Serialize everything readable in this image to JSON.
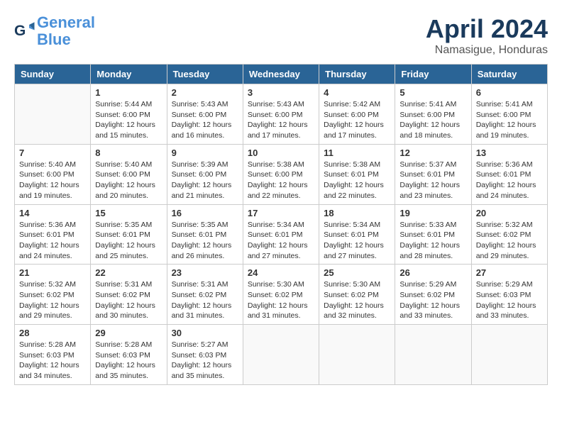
{
  "header": {
    "logo_line1": "General",
    "logo_line2": "Blue",
    "month": "April 2024",
    "location": "Namasigue, Honduras"
  },
  "weekdays": [
    "Sunday",
    "Monday",
    "Tuesday",
    "Wednesday",
    "Thursday",
    "Friday",
    "Saturday"
  ],
  "weeks": [
    [
      {
        "day": "",
        "info": ""
      },
      {
        "day": "1",
        "info": "Sunrise: 5:44 AM\nSunset: 6:00 PM\nDaylight: 12 hours\nand 15 minutes."
      },
      {
        "day": "2",
        "info": "Sunrise: 5:43 AM\nSunset: 6:00 PM\nDaylight: 12 hours\nand 16 minutes."
      },
      {
        "day": "3",
        "info": "Sunrise: 5:43 AM\nSunset: 6:00 PM\nDaylight: 12 hours\nand 17 minutes."
      },
      {
        "day": "4",
        "info": "Sunrise: 5:42 AM\nSunset: 6:00 PM\nDaylight: 12 hours\nand 17 minutes."
      },
      {
        "day": "5",
        "info": "Sunrise: 5:41 AM\nSunset: 6:00 PM\nDaylight: 12 hours\nand 18 minutes."
      },
      {
        "day": "6",
        "info": "Sunrise: 5:41 AM\nSunset: 6:00 PM\nDaylight: 12 hours\nand 19 minutes."
      }
    ],
    [
      {
        "day": "7",
        "info": "Sunrise: 5:40 AM\nSunset: 6:00 PM\nDaylight: 12 hours\nand 19 minutes."
      },
      {
        "day": "8",
        "info": "Sunrise: 5:40 AM\nSunset: 6:00 PM\nDaylight: 12 hours\nand 20 minutes."
      },
      {
        "day": "9",
        "info": "Sunrise: 5:39 AM\nSunset: 6:00 PM\nDaylight: 12 hours\nand 21 minutes."
      },
      {
        "day": "10",
        "info": "Sunrise: 5:38 AM\nSunset: 6:00 PM\nDaylight: 12 hours\nand 22 minutes."
      },
      {
        "day": "11",
        "info": "Sunrise: 5:38 AM\nSunset: 6:01 PM\nDaylight: 12 hours\nand 22 minutes."
      },
      {
        "day": "12",
        "info": "Sunrise: 5:37 AM\nSunset: 6:01 PM\nDaylight: 12 hours\nand 23 minutes."
      },
      {
        "day": "13",
        "info": "Sunrise: 5:36 AM\nSunset: 6:01 PM\nDaylight: 12 hours\nand 24 minutes."
      }
    ],
    [
      {
        "day": "14",
        "info": "Sunrise: 5:36 AM\nSunset: 6:01 PM\nDaylight: 12 hours\nand 24 minutes."
      },
      {
        "day": "15",
        "info": "Sunrise: 5:35 AM\nSunset: 6:01 PM\nDaylight: 12 hours\nand 25 minutes."
      },
      {
        "day": "16",
        "info": "Sunrise: 5:35 AM\nSunset: 6:01 PM\nDaylight: 12 hours\nand 26 minutes."
      },
      {
        "day": "17",
        "info": "Sunrise: 5:34 AM\nSunset: 6:01 PM\nDaylight: 12 hours\nand 27 minutes."
      },
      {
        "day": "18",
        "info": "Sunrise: 5:34 AM\nSunset: 6:01 PM\nDaylight: 12 hours\nand 27 minutes."
      },
      {
        "day": "19",
        "info": "Sunrise: 5:33 AM\nSunset: 6:01 PM\nDaylight: 12 hours\nand 28 minutes."
      },
      {
        "day": "20",
        "info": "Sunrise: 5:32 AM\nSunset: 6:02 PM\nDaylight: 12 hours\nand 29 minutes."
      }
    ],
    [
      {
        "day": "21",
        "info": "Sunrise: 5:32 AM\nSunset: 6:02 PM\nDaylight: 12 hours\nand 29 minutes."
      },
      {
        "day": "22",
        "info": "Sunrise: 5:31 AM\nSunset: 6:02 PM\nDaylight: 12 hours\nand 30 minutes."
      },
      {
        "day": "23",
        "info": "Sunrise: 5:31 AM\nSunset: 6:02 PM\nDaylight: 12 hours\nand 31 minutes."
      },
      {
        "day": "24",
        "info": "Sunrise: 5:30 AM\nSunset: 6:02 PM\nDaylight: 12 hours\nand 31 minutes."
      },
      {
        "day": "25",
        "info": "Sunrise: 5:30 AM\nSunset: 6:02 PM\nDaylight: 12 hours\nand 32 minutes."
      },
      {
        "day": "26",
        "info": "Sunrise: 5:29 AM\nSunset: 6:02 PM\nDaylight: 12 hours\nand 33 minutes."
      },
      {
        "day": "27",
        "info": "Sunrise: 5:29 AM\nSunset: 6:03 PM\nDaylight: 12 hours\nand 33 minutes."
      }
    ],
    [
      {
        "day": "28",
        "info": "Sunrise: 5:28 AM\nSunset: 6:03 PM\nDaylight: 12 hours\nand 34 minutes."
      },
      {
        "day": "29",
        "info": "Sunrise: 5:28 AM\nSunset: 6:03 PM\nDaylight: 12 hours\nand 35 minutes."
      },
      {
        "day": "30",
        "info": "Sunrise: 5:27 AM\nSunset: 6:03 PM\nDaylight: 12 hours\nand 35 minutes."
      },
      {
        "day": "",
        "info": ""
      },
      {
        "day": "",
        "info": ""
      },
      {
        "day": "",
        "info": ""
      },
      {
        "day": "",
        "info": ""
      }
    ]
  ]
}
